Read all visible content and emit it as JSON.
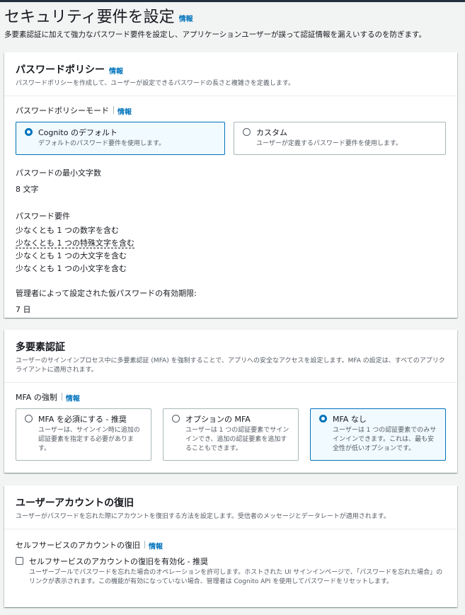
{
  "page": {
    "title": "セキュリティ要件を設定",
    "info": "情報",
    "description": "多要素認証に加えて強力なパスワード要件を設定し、アプリケーションユーザーが誤って認証情報を漏えいするのを防ぎます。"
  },
  "password_policy": {
    "title": "パスワードポリシー",
    "info": "情報",
    "description": "パスワードポリシーを作成して、ユーザーが設定できるパスワードの長さと複雑さを定義します。",
    "mode_label": "パスワードポリシーモード",
    "mode_info": "情報",
    "options": [
      {
        "title": "Cognito のデフォルト",
        "desc": "デフォルトのパスワード要件を使用します。",
        "selected": true
      },
      {
        "title": "カスタム",
        "desc": "ユーザーが定義するパスワード要件を使用します。",
        "selected": false
      }
    ],
    "min_length_label": "パスワードの最小文字数",
    "min_length_value": "8 文字",
    "requirements_label": "パスワード要件",
    "requirements": [
      "少なくとも 1 つの数字を含む",
      "少なくとも 1 つの特殊文字を含む",
      "少なくとも 1 つの大文字を含む",
      "少なくとも 1 つの小文字を含む"
    ],
    "temp_password_label": "管理者によって設定された仮パスワードの有効期限:",
    "temp_password_value": "7 日"
  },
  "mfa": {
    "title": "多要素認証",
    "description": "ユーザーのサインインプロセス中に多要素認証 (MFA) を強制することで、アプリへの安全なアクセスを設定します。MFA の設定は、すべてのアプリクライアントに適用されます。",
    "enforcement_label": "MFA の強制",
    "enforcement_info": "情報",
    "options": [
      {
        "title": "MFA を必須にする - 推奨",
        "desc": "ユーザーは、サインイン時に追加の認証要素を指定する必要があります。",
        "selected": false
      },
      {
        "title": "オプションの MFA",
        "desc": "ユーザーは 1 つの認証要素でサインインでき、追加の認証要素を追加することもできます。",
        "selected": false
      },
      {
        "title": "MFA なし",
        "desc": "ユーザーは 1 つの認証要素でのみサインインできます。これは、最も安全性が低いオプションです。",
        "selected": true
      }
    ]
  },
  "recovery": {
    "title": "ユーザーアカウントの復旧",
    "description": "ユーザーがパスワードを忘れた際にアカウントを復旧する方法を設定します。受信者のメッセージとデータレートが適用されます。",
    "self_service_label": "セルフサービスのアカウントの復旧",
    "self_service_info": "情報",
    "checkbox_title": "セルフサービスのアカウントの復旧を有効化 - 推奨",
    "checkbox_desc": "ユーザープールでパスワードを忘れた場合のオペレーションを許可します。ホストされた UI サインインページで、「パスワードを忘れた場合」のリンクが表示されます。この機能が有効になっていない場合、管理者は Cognito API を使用してパスワードをリセットします。",
    "checked": false
  },
  "colors": {
    "accent": "#0073bb",
    "background": "#f2f3f3",
    "panel": "#ffffff",
    "text": "#16191f",
    "secondary_text": "#545b64"
  }
}
